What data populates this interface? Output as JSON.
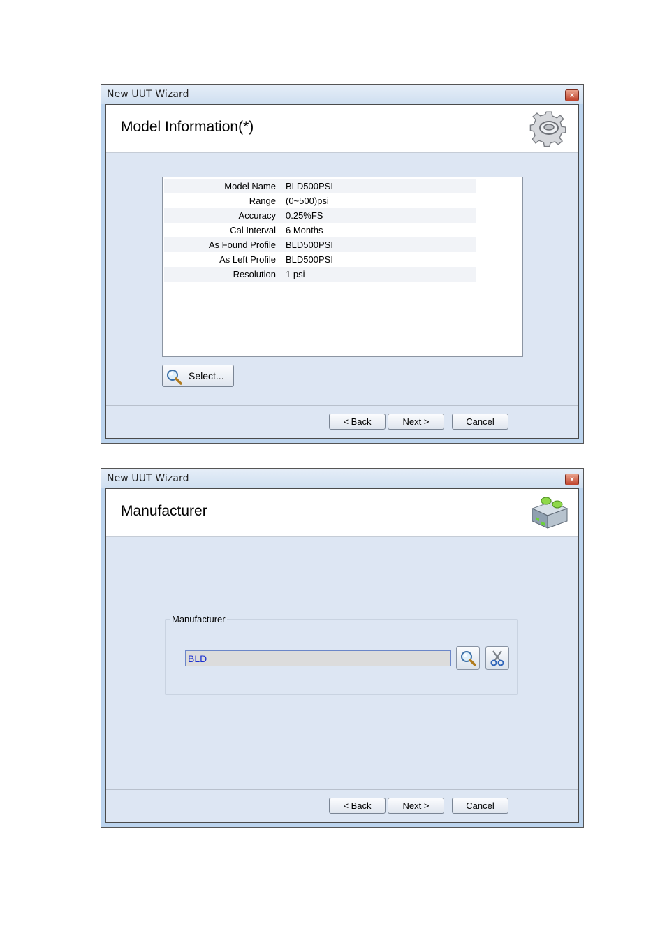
{
  "windows": [
    {
      "title": "New UUT Wizard",
      "close_label": "x",
      "header_title": "Model Information(*)",
      "header_icon": "gear-icon",
      "model_rows": [
        {
          "label": "Model Name",
          "value": "BLD500PSI"
        },
        {
          "label": "Range",
          "value": "(0~500)psi"
        },
        {
          "label": "Accuracy",
          "value": "0.25%FS"
        },
        {
          "label": "Cal Interval",
          "value": "6 Months"
        },
        {
          "label": "As Found Profile",
          "value": "BLD500PSI"
        },
        {
          "label": "As Left Profile",
          "value": "BLD500PSI"
        },
        {
          "label": "Resolution",
          "value": "1 psi"
        }
      ],
      "select_label": "Select...",
      "buttons": {
        "back": "< Back",
        "next": "Next >",
        "cancel": "Cancel"
      }
    },
    {
      "title": "New UUT Wizard",
      "close_label": "x",
      "header_title": "Manufacturer",
      "header_icon": "factory-building-icon",
      "group_label": "Manufacturer",
      "manufacturer_value": "BLD",
      "search_icon": "magnifier-icon",
      "clear_icon": "scissors-icon",
      "buttons": {
        "back": "< Back",
        "next": "Next >",
        "cancel": "Cancel"
      }
    }
  ]
}
